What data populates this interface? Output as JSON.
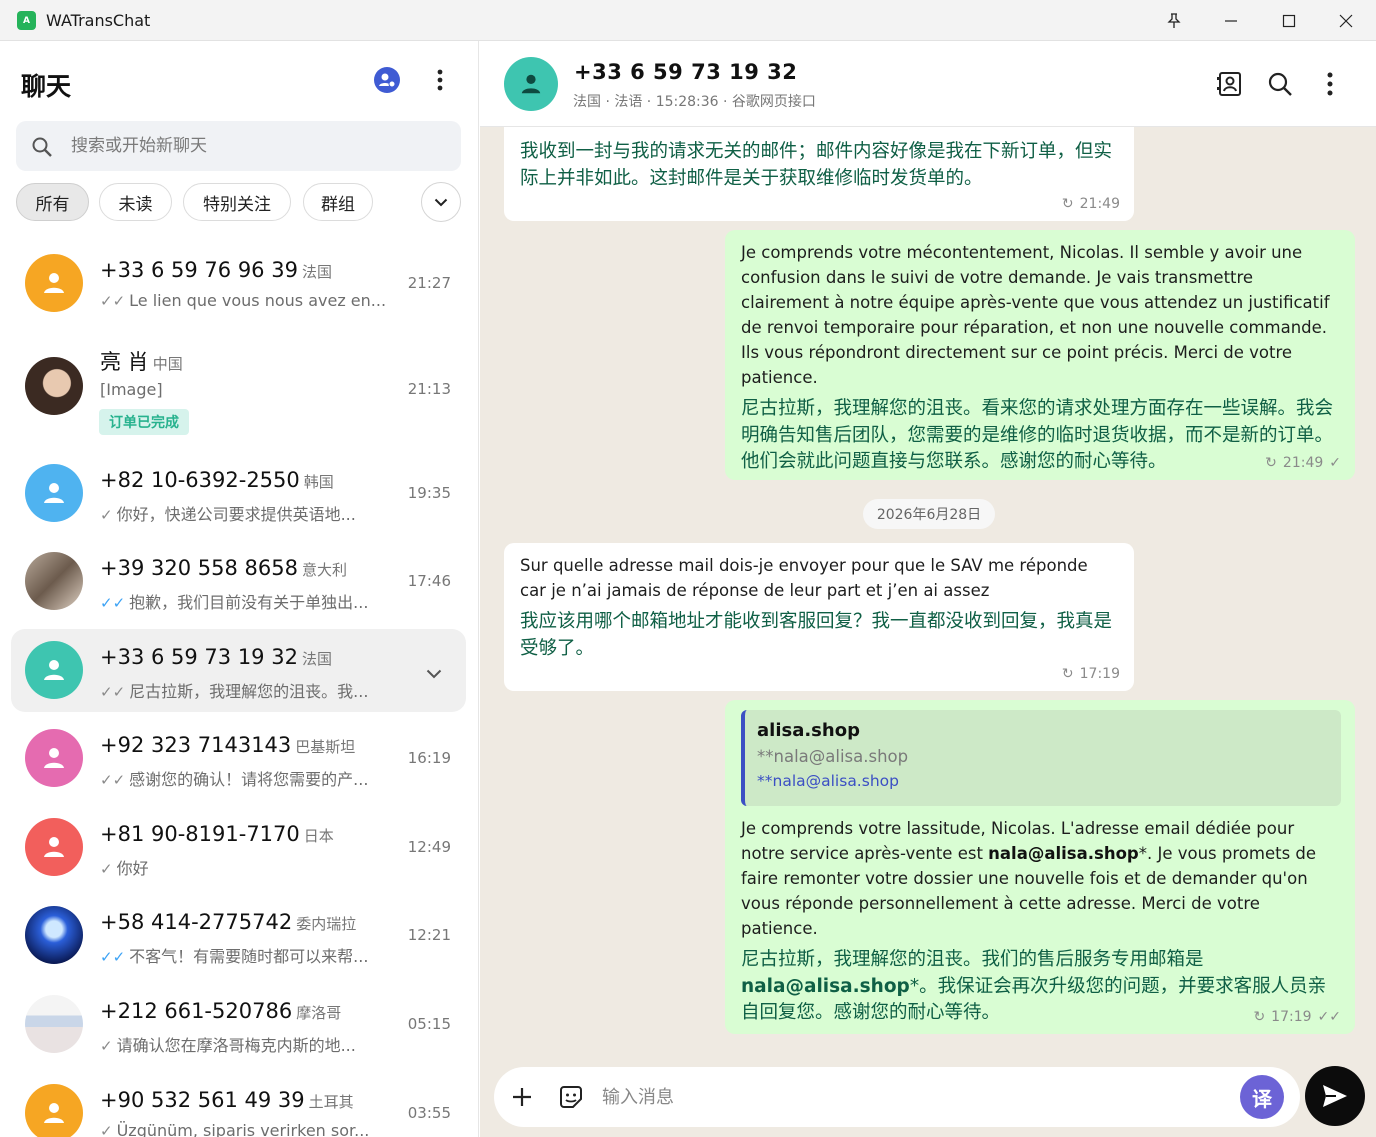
{
  "window": {
    "title": "WATransChat",
    "app_icon_text": "A"
  },
  "sidebar": {
    "title": "聊天",
    "search_placeholder": "搜索或开始新聊天",
    "filters": [
      "所有",
      "未读",
      "特别关注",
      "群组"
    ],
    "chats": [
      {
        "name": "+33 6 59 76 96 39",
        "country": "法国",
        "preview": "Le lien que vous nous avez en...",
        "tick": "double-grey",
        "time": "21:27",
        "avatar_color": "#f6a623"
      },
      {
        "name": "亮 肖",
        "country": "中国",
        "preview": "[Image]",
        "tick": "none",
        "time": "21:13",
        "tag": "订单已完成",
        "avatar": "photo"
      },
      {
        "name": "+82 10-6392-2550",
        "country": "韩国",
        "preview": "你好，快递公司要求提供英语地...",
        "tick": "single-grey",
        "time": "19:35",
        "avatar_color": "#4fb3f0"
      },
      {
        "name": "+39 320 558 8658",
        "country": "意大利",
        "preview": "抱歉，我们目前没有关于单独出...",
        "tick": "double-blue",
        "time": "17:46",
        "avatar": "photo"
      },
      {
        "name": "+33 6 59 73 19 32",
        "country": "法国",
        "preview": "尼古拉斯，我理解您的沮丧。我...",
        "tick": "double-grey",
        "time": "",
        "avatar_color": "#3ec5b0",
        "selected": true
      },
      {
        "name": "+92 323 7143143",
        "country": "巴基斯坦",
        "preview": "感谢您的确认！请将您需要的产...",
        "tick": "double-grey",
        "time": "16:19",
        "avatar_color": "#e56bb0"
      },
      {
        "name": "+81 90-8191-7170",
        "country": "日本",
        "preview": "你好",
        "tick": "single-grey",
        "time": "12:49",
        "avatar_color": "#f25f5c"
      },
      {
        "name": "+58 414-2775742",
        "country": "委内瑞拉",
        "preview": "不客气！有需要随时都可以来帮...",
        "tick": "double-blue",
        "time": "12:21",
        "avatar": "photo"
      },
      {
        "name": "+212 661-520786",
        "country": "摩洛哥",
        "preview": "请确认您在摩洛哥梅克内斯的地...",
        "tick": "single-grey",
        "time": "05:15",
        "avatar": "photo"
      },
      {
        "name": "+90 532 561 49 39",
        "country": "土耳其",
        "preview": "Üzgünüm, siparis verirken sor...",
        "tick": "single-grey",
        "time": "03:55",
        "avatar_color": "#f6a623"
      }
    ]
  },
  "conversation": {
    "contact_name": "+33 6 59 73 19 32",
    "contact_sub": "法国 · 法语 · 15:28:36 · 谷歌网页接口",
    "messages": [
      {
        "dir": "in",
        "trans": "我收到一封与我的请求无关的邮件；邮件内容好像是我在下新订单，但实际上并非如此。这封邮件是关于获取维修临时发货单的。",
        "time": "21:49"
      },
      {
        "dir": "out",
        "orig": "Je comprends votre mécontentement, Nicolas. Il semble y avoir une confusion dans le suivi de votre demande. Je vais transmettre clairement à notre équipe après-vente que vous attendez un justificatif de renvoi temporaire pour réparation, et non une nouvelle commande. Ils vous répondront directement sur ce point précis. Merci de votre patience.",
        "trans": "尼古拉斯，我理解您的沮丧。看来您的请求处理方面存在一些误解。我会明确告知售后团队，您需要的是维修的临时退货收据，而不是新的订单。他们会就此问题直接与您联系。感谢您的耐心等待。",
        "time": "21:49"
      },
      {
        "dir": "in",
        "orig": "Sur quelle adresse mail dois-je envoyer pour que le SAV me réponde car je n’ai jamais de réponse de leur part et j’en ai assez",
        "trans": "我应该用哪个邮箱地址才能收到客服回复？我一直都没收到回复，我真是受够了。",
        "time": "17:19"
      },
      {
        "dir": "out",
        "quote_title": "alisa.shop",
        "quote_line1": "**nala@alisa.shop",
        "quote_line2": "**nala@alisa.shop",
        "orig_a": "Je comprends votre lassitude, Nicolas. L'adresse email dédiée pour notre service après-vente est ",
        "orig_bold": "nala@alisa.shop",
        "orig_b": "*. Je vous promets de faire remonter votre dossier une nouvelle fois et de demander qu'on vous réponde personnellement à cette adresse. Merci de votre patience.",
        "trans_a": "尼古拉斯，我理解您的沮丧。我们的售后服务专用邮箱是",
        "trans_bold": "nala@alisa.shop",
        "trans_b": "*。我保证会再次升级您的问题，并要求客服人员亲自回复您。感谢您的耐心等待。",
        "time": "17:19"
      }
    ],
    "date_divider": "2026年6月28日",
    "composer_placeholder": "输入消息",
    "translate_label": "译"
  },
  "colors": {
    "accent": "#25b35a",
    "incoming": "#ffffff",
    "outgoing": "#d9fdd3",
    "translate": "#6c63d6"
  }
}
